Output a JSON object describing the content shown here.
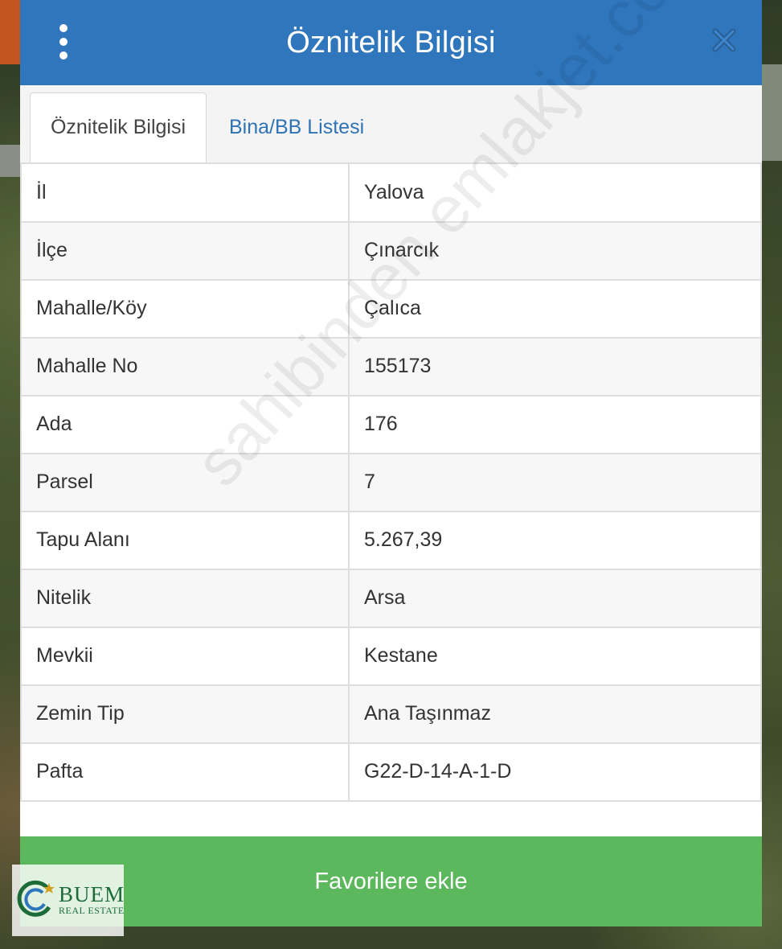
{
  "header": {
    "title": "Öznitelik Bilgisi",
    "menu_icon": "vertical-dots-icon",
    "close_icon": "close-icon"
  },
  "tabs": [
    {
      "label": "Öznitelik Bilgisi",
      "active": true
    },
    {
      "label": "Bina/BB Listesi",
      "active": false
    }
  ],
  "attributes": [
    {
      "key": "İl",
      "value": "Yalova"
    },
    {
      "key": "İlçe",
      "value": "Çınarcık"
    },
    {
      "key": "Mahalle/Köy",
      "value": "Çalıca"
    },
    {
      "key": "Mahalle No",
      "value": "155173"
    },
    {
      "key": "Ada",
      "value": "176"
    },
    {
      "key": "Parsel",
      "value": "7"
    },
    {
      "key": "Tapu Alanı",
      "value": "5.267,39"
    },
    {
      "key": "Nitelik",
      "value": "Arsa"
    },
    {
      "key": "Mevkii",
      "value": "Kestane"
    },
    {
      "key": "Zemin Tip",
      "value": "Ana Taşınmaz"
    },
    {
      "key": "Pafta",
      "value": "G22-D-14-A-1-D"
    }
  ],
  "footer": {
    "favorite_label": "Favorilere ekle"
  },
  "watermark": "sahibinden emlakjet.com",
  "logo": {
    "name": "BUEM",
    "subtitle": "REAL ESTATE"
  },
  "colors": {
    "header": "#2f76bd",
    "tab_link": "#2f73b5",
    "button": "#5cb85c",
    "logo": "#1e6b3a"
  }
}
